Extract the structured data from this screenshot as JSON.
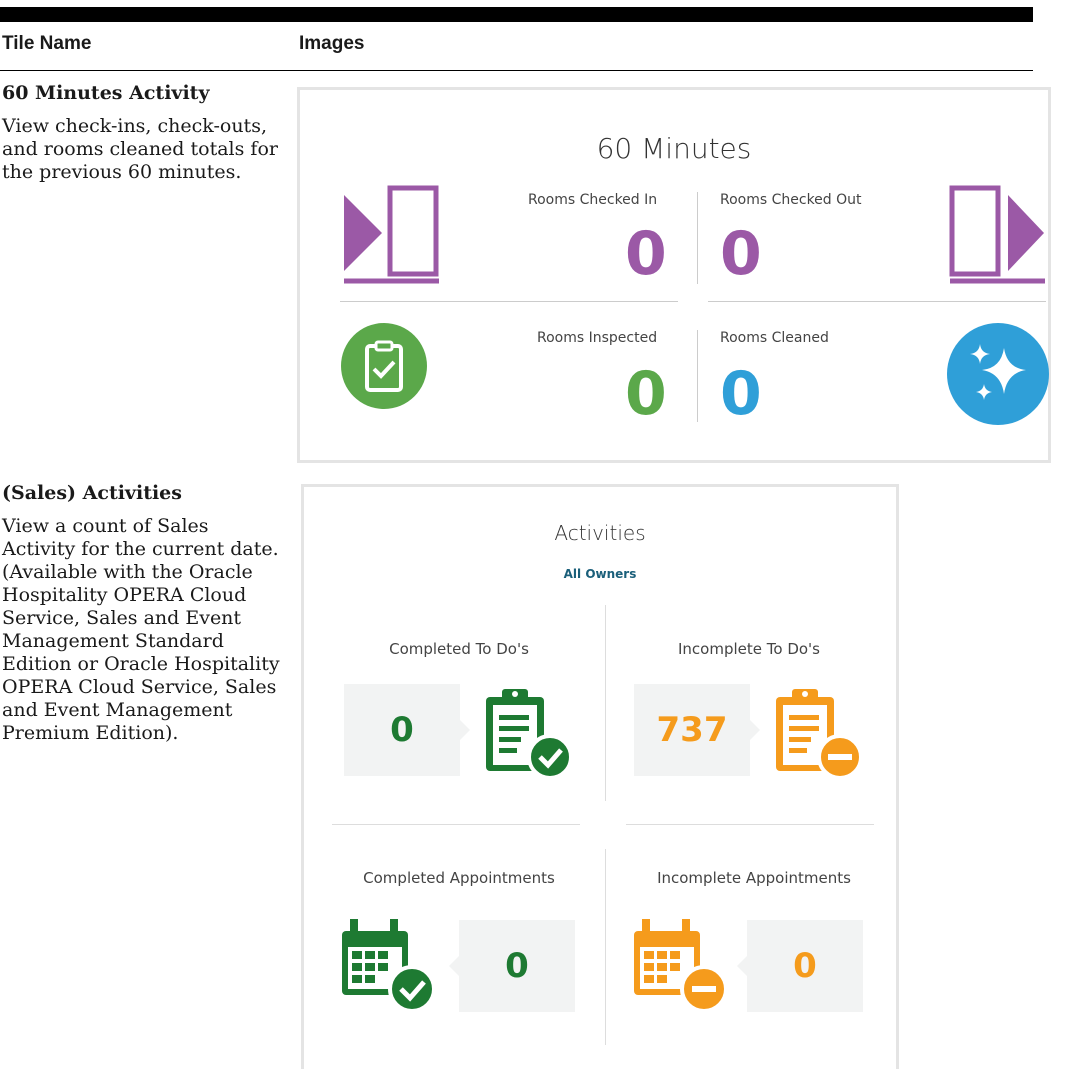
{
  "table": {
    "col_tile_name": "Tile Name",
    "col_images": "Images"
  },
  "rows": [
    {
      "name": "60 Minutes Activity",
      "description": "View check-ins, check-outs, and rooms cleaned totals for the previous 60 minutes."
    },
    {
      "name": "(Sales) Activities",
      "description": "View a count of Sales Activity for the current date. (Available with the Oracle Hospitality OPERA Cloud Service, Sales and Event Management Standard Edition or Oracle Hospitality OPERA Cloud Service, Sales and Event Management Premium Edition)."
    }
  ],
  "minutes_tile": {
    "title": "60 Minutes",
    "checked_in_label": "Rooms Checked In",
    "checked_in_value": "0",
    "checked_out_label": "Rooms Checked Out",
    "checked_out_value": "0",
    "inspected_label": "Rooms Inspected",
    "inspected_value": "0",
    "cleaned_label": "Rooms Cleaned",
    "cleaned_value": "0",
    "icons": [
      "door-enter-icon",
      "door-exit-icon",
      "clipboard-check-icon",
      "sparkle-icon"
    ],
    "colors": {
      "purple": "#9b59a6",
      "green": "#5ba84a",
      "blue": "#2f9fd8"
    }
  },
  "activities_tile": {
    "title": "Activities",
    "owner_filter": "All Owners",
    "completed_todos_label": "Completed To Do's",
    "completed_todos_value": "0",
    "incomplete_todos_label": "Incomplete To Do's",
    "incomplete_todos_value": "737",
    "completed_appts_label": "Completed Appointments",
    "completed_appts_value": "0",
    "incomplete_appts_label": "Incomplete Appointments",
    "incomplete_appts_value": "0",
    "icons": [
      "clipboard-check-icon",
      "clipboard-minus-icon",
      "calendar-check-icon",
      "calendar-minus-icon"
    ],
    "colors": {
      "green": "#1e7a32",
      "orange": "#f59b1c",
      "link": "#1a5f7a"
    }
  }
}
